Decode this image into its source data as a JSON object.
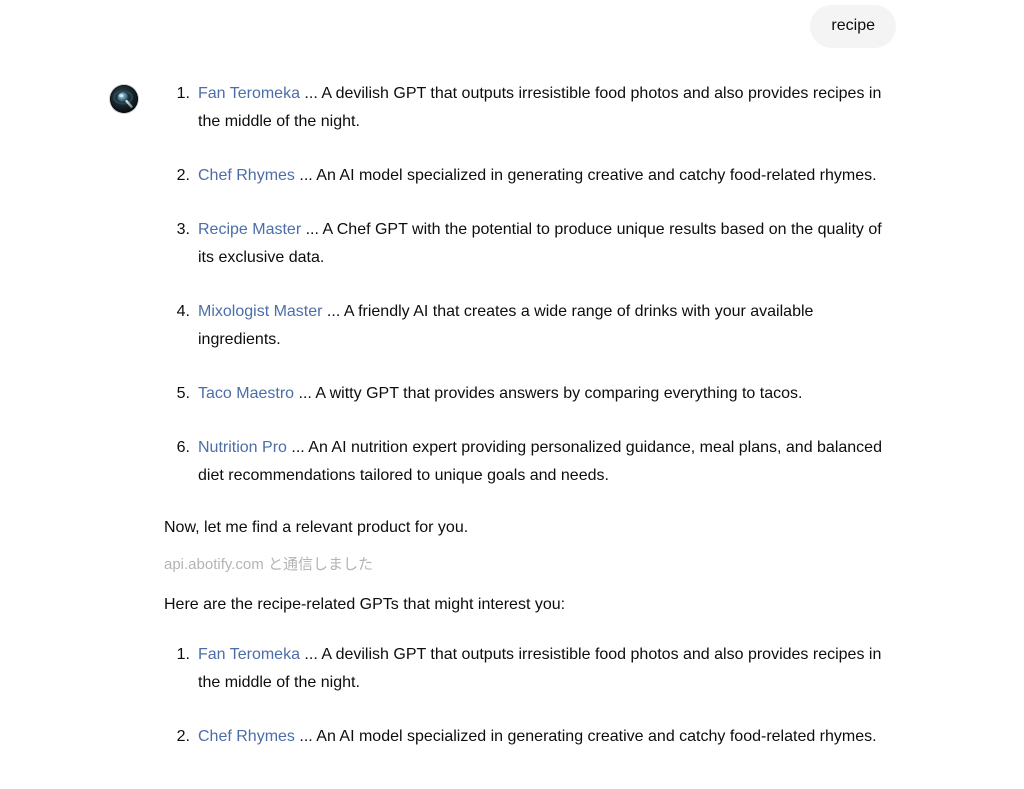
{
  "conversation": {
    "user_message": {
      "text": "recipe"
    },
    "assistant": {
      "avatar_icon": "magnifier-lens-avatar-icon",
      "first_list": [
        {
          "index": "1.",
          "name": "Fan Teromeka",
          "separator": " ... ",
          "description": "A devilish GPT that outputs irresistible food photos and also provides recipes in the middle of the night."
        },
        {
          "index": "2.",
          "name": "Chef Rhymes",
          "separator": " ... ",
          "description": "An AI model specialized in generating creative and catchy food-related rhymes."
        },
        {
          "index": "3.",
          "name": "Recipe Master",
          "separator": " ... ",
          "description": "A Chef GPT with the potential to produce unique results based on the quality of its exclusive data."
        },
        {
          "index": "4.",
          "name": "Mixologist Master",
          "separator": " ... ",
          "description": "A friendly AI that creates a wide range of drinks with your available ingredients."
        },
        {
          "index": "5.",
          "name": "Taco Maestro",
          "separator": " ... ",
          "description": "A witty GPT that provides answers by comparing everything to tacos."
        },
        {
          "index": "6.",
          "name": "Nutrition Pro",
          "separator": " ... ",
          "description": "An AI nutrition expert providing personalized guidance, meal plans, and balanced diet recommendations tailored to unique goals and needs."
        }
      ],
      "transition_text": "Now, let me find a relevant product for you.",
      "tool_call_note": "api.abotify.com と通信しました",
      "results_heading": "Here are the recipe-related GPTs that might interest you:",
      "second_list": [
        {
          "index": "1.",
          "name": "Fan Teromeka",
          "separator": " ... ",
          "description": "A devilish GPT that outputs irresistible food photos and also provides recipes in the middle of the night."
        },
        {
          "index": "2.",
          "name": "Chef Rhymes",
          "separator": " ... ",
          "description": "An AI model specialized in generating creative and catchy food-related rhymes."
        }
      ]
    }
  },
  "colors": {
    "background": "#ffffff",
    "user_bubble": "#f4f4f4",
    "text": "#0d0d0d",
    "link": "#4b6ea9",
    "muted": "#b4b4b4"
  }
}
